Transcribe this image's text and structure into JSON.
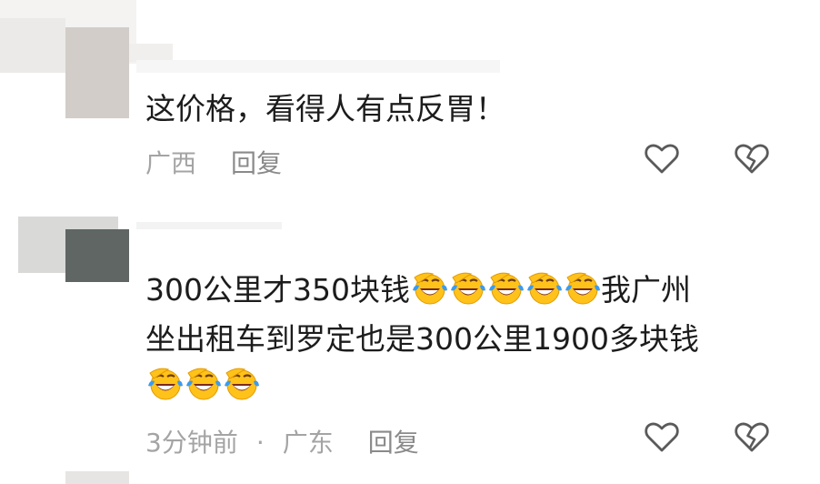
{
  "comments": [
    {
      "text": "这价格，看得人有点反胃！",
      "location": "广西",
      "reply_label": "回复"
    },
    {
      "lines": [
        {
          "before": "300公里才350块钱",
          "emoji_count": 5,
          "after": "我广州"
        },
        {
          "before": "坐出租车到罗定也是300公里1900多块钱",
          "emoji_count": 0,
          "after": ""
        },
        {
          "before": "",
          "emoji_count": 3,
          "after": ""
        }
      ],
      "time": "3分钟前",
      "separator": "·",
      "location": "广东",
      "reply_label": "回复"
    }
  ],
  "icons": {
    "like": "heart-outline-icon",
    "dislike": "broken-heart-icon",
    "emoji": "laughing-crying-emoji-icon"
  },
  "colors": {
    "text": "#1c1c1c",
    "meta": "#a4a4a4",
    "icon": "#5a5a5a",
    "emoji_face": "#ffc21a",
    "emoji_tears": "#3a9bf0"
  }
}
